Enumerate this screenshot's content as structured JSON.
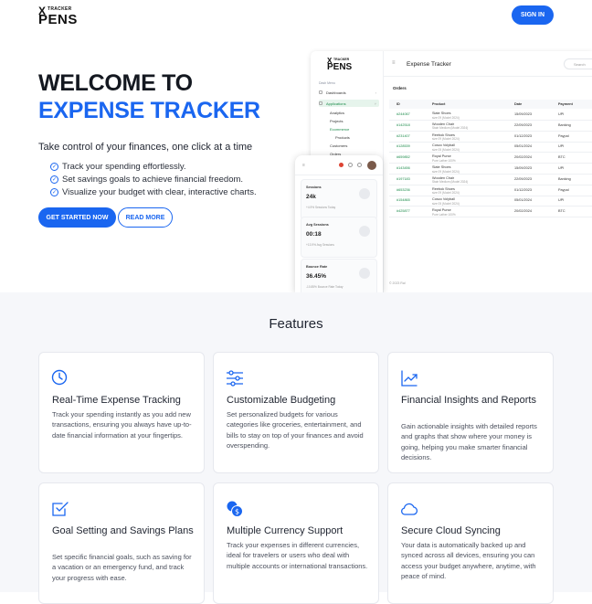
{
  "brand": {
    "logo_x": "X",
    "logo_top": "TRACKER",
    "logo_bottom": "PENS"
  },
  "nav": {
    "signin": "SIGN IN"
  },
  "hero": {
    "title_line1": "WELCOME TO",
    "title_line2": "EXPENSE TRACKER",
    "tagline": "Take control of your finances, one click at a time",
    "bullets": [
      "Track your spending effortlessly.",
      "Set savings goals to achieve financial freedom.",
      "Visualize your budget with clear, interactive charts."
    ],
    "cta_primary": "GET STARTED NOW",
    "cta_secondary": "READ MORE"
  },
  "mockup": {
    "title": "Expense Tracker",
    "search_placeholder": "Search",
    "section_label": "Dash Menu",
    "sidebar": [
      "Dashboards",
      "Applications",
      "Analytics",
      "Projects",
      "Ecommerce"
    ],
    "sub_items": [
      "Products",
      "Customers",
      "Orders"
    ],
    "orders_title": "Orders",
    "columns": [
      "ID",
      "Product",
      "Date",
      "Payment"
    ],
    "rows": [
      {
        "id": "#244067",
        "product": "Slate Shoes",
        "variant": "size 09 (Model 2024)",
        "date": "15/09/2023",
        "payment": "UPI"
      },
      {
        "id": "#142518",
        "product": "Wooden Chair",
        "variant": "Stain Medium (Model 2024)",
        "date": "22/09/2023",
        "payment": "Banking"
      },
      {
        "id": "#231407",
        "product": "Reebok Shoes",
        "variant": "size 09 (Model 2024)",
        "date": "01/12/2023",
        "payment": "Paypal"
      },
      {
        "id": "#128539",
        "product": "Cosco Volyball",
        "variant": "size 05 (Model 2024)",
        "date": "05/01/2024",
        "payment": "UPI"
      },
      {
        "id": "#659852",
        "product": "Royal Purse",
        "variant": "Pure Lather 100%",
        "date": "20/02/2024",
        "payment": "BTC"
      },
      {
        "id": "#143456",
        "product": "Slate Shoes",
        "variant": "size 09 (Model 2024)",
        "date": "15/09/2023",
        "payment": "UPI"
      },
      {
        "id": "#197183",
        "product": "Wooden Chair",
        "variant": "Stain Medium (Model 2024)",
        "date": "22/09/2023",
        "payment": "Banking"
      },
      {
        "id": "#653236",
        "product": "Reebok Shoes",
        "variant": "size 09 (Model 2024)",
        "date": "01/12/2023",
        "payment": "Paypal"
      },
      {
        "id": "#154865",
        "product": "Cosco Volyball",
        "variant": "size 05 (Model 2024)",
        "date": "05/01/2024",
        "payment": "UPI"
      },
      {
        "id": "#425877",
        "product": "Royal Purse",
        "variant": "Pure Lather 100%",
        "date": "20/02/2024",
        "payment": "BTC"
      }
    ],
    "footer": "© 2023 Ral",
    "phone_cards": [
      {
        "label": "Sessions",
        "value": "24k",
        "note": "+4.9% Sessions Today"
      },
      {
        "label": "Avg Sessions",
        "value": "00:18",
        "note": "+13.9% Avg Sessions"
      },
      {
        "label": "Bounce Rate",
        "value": "36.45%",
        "note": "-10.85% Bounce Rate Today"
      }
    ]
  },
  "features": {
    "title": "Features",
    "cards": [
      {
        "icon": "clock-icon",
        "title": "Real-Time Expense Tracking",
        "desc": "Track your spending instantly as you add new transactions, ensuring you always have up-to-date financial information at your fingertips."
      },
      {
        "icon": "sliders-icon",
        "title": "Customizable Budgeting",
        "desc": "Set personalized budgets for various categories like groceries, entertainment, and bills to stay on top of your finances and avoid overspending."
      },
      {
        "icon": "trending-chart-icon",
        "title": "Financial Insights and Reports",
        "desc": "Gain actionable insights with detailed reports and graphs that show where your money is going, helping you make smarter financial decisions."
      },
      {
        "icon": "checkbox-icon",
        "title": "Goal Setting and Savings Plans",
        "desc": "Set specific financial goals, such as saving for a vacation or an emergency fund, and track your progress with ease."
      },
      {
        "icon": "coins-icon",
        "title": "Multiple Currency Support",
        "desc": "Track your expenses in different currencies, ideal for travelers or users who deal with multiple accounts or international transactions."
      },
      {
        "icon": "cloud-icon",
        "title": "Secure Cloud Syncing",
        "desc": "Your data is automatically backed up and synced across all devices, ensuring you can access your budget anywhere, anytime, with peace of mind."
      }
    ]
  },
  "colors": {
    "accent": "#1a66f0",
    "text": "#1f2430",
    "section_bg": "#f6f7fa",
    "green": "#1b8b4a"
  }
}
